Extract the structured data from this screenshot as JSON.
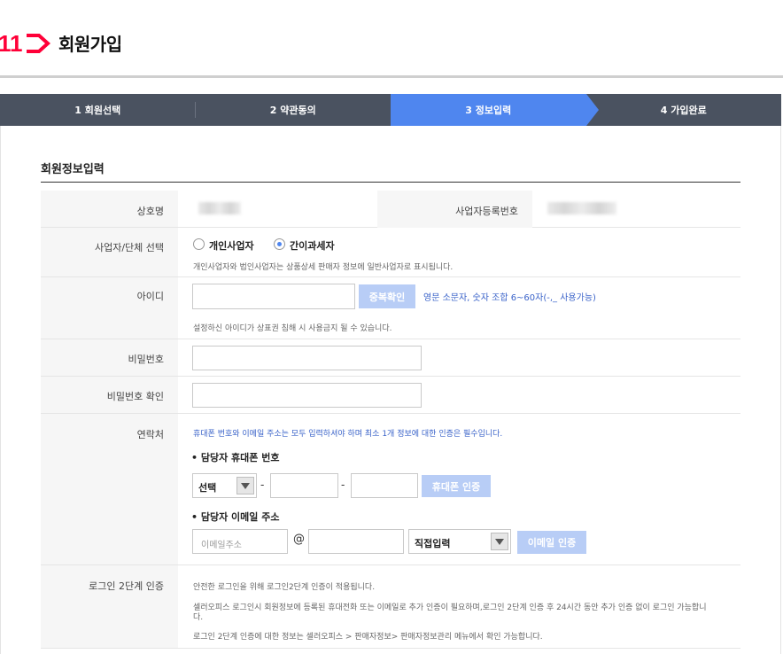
{
  "header": {
    "logo_text": "11",
    "title": "회원가입"
  },
  "steps": [
    {
      "label": "1  회원선택"
    },
    {
      "label": "2  약관동의"
    },
    {
      "label": "3  정보입력"
    },
    {
      "label": "4  가입완료"
    }
  ],
  "section_title": "회원정보입력",
  "rows": {
    "company": {
      "label": "상호명",
      "biz_no_label": "사업자등록번호"
    },
    "biz_type": {
      "label": "사업자/단체 선택",
      "option1": "개인사업자",
      "option2": "간이과세자",
      "selected": "간이과세자",
      "note": "개인사업자와 법인사업자는 상품상세 판매자 정보에 일반사업자로 표시됩니다."
    },
    "id": {
      "label": "아이디",
      "check_button": "중복확인",
      "hint": "영문 소문자, 숫자 조합 6~60자(-,_ 사용가능)",
      "note": "설정하신 아이디가 상표권 침해 시 사용금지 될 수 있습니다."
    },
    "password": {
      "label": "비밀번호"
    },
    "password_confirm": {
      "label": "비밀번호 확인"
    },
    "contact": {
      "label": "연락처",
      "note": "휴대폰 번호와 이메일 주소는 모두 입력하셔야 하며 최소 1개 정보에 대한 인증은 필수입니다.",
      "phone_title": "• 담당자 휴대폰 번호",
      "phone_select": "선택",
      "phone_dash": "-",
      "phone_verify_button": "휴대폰 인증",
      "email_title": "• 담당자 이메일 주소",
      "email_placeholder": "이메일주소",
      "at": "@",
      "domain_select": "직접입력",
      "email_verify_button": "이메일 인증"
    },
    "two_factor": {
      "label": "로그인 2단계 인증",
      "line1": "안전한 로그인을 위해 로그인2단계 인증이 적용됩니다.",
      "line2a": "셀러오피스 로그인시 회원정보에 등록된 휴대전화 또는 이메일로 추가 인증이 필요하며,로그인 2단계 인증 후 24시간 동안 추가 인증 없이 로그인 가능합니",
      "line2b": "다.",
      "line3": "로그인 2단계 인증에 대한 정보는 셀러오피스 > 판매자정보> 판매자정보관리 메뉴에서 확인 가능합니다."
    }
  },
  "colors": {
    "brand": "#ff0038",
    "active_step": "#4f86ef",
    "step_bar": "#4a5260",
    "button_disabled": "#b8cdf6",
    "link_blue": "#3a63c9"
  }
}
